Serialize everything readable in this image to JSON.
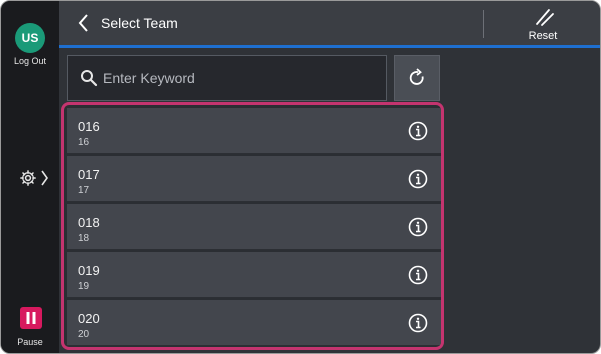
{
  "user": {
    "initials": "US",
    "logout_label": "Log Out"
  },
  "pause": {
    "label": "Pause"
  },
  "header": {
    "title": "Select Team",
    "reset_label": "Reset"
  },
  "search": {
    "placeholder": "Enter Keyword",
    "value": ""
  },
  "teams": [
    {
      "name": "016",
      "id": "16"
    },
    {
      "name": "017",
      "id": "17"
    },
    {
      "name": "018",
      "id": "18"
    },
    {
      "name": "019",
      "id": "19"
    },
    {
      "name": "020",
      "id": "20"
    }
  ],
  "colors": {
    "accent": "#1e6fd0",
    "avatar": "#1a9a78",
    "pause": "#d7195e",
    "highlight": "#c4346f"
  },
  "icons": {
    "back": "chevron-left-icon",
    "reset": "reset-icon",
    "search": "search-icon",
    "refresh": "refresh-icon",
    "info": "info-icon",
    "settings": "gear-icon",
    "pause": "pause-icon"
  }
}
